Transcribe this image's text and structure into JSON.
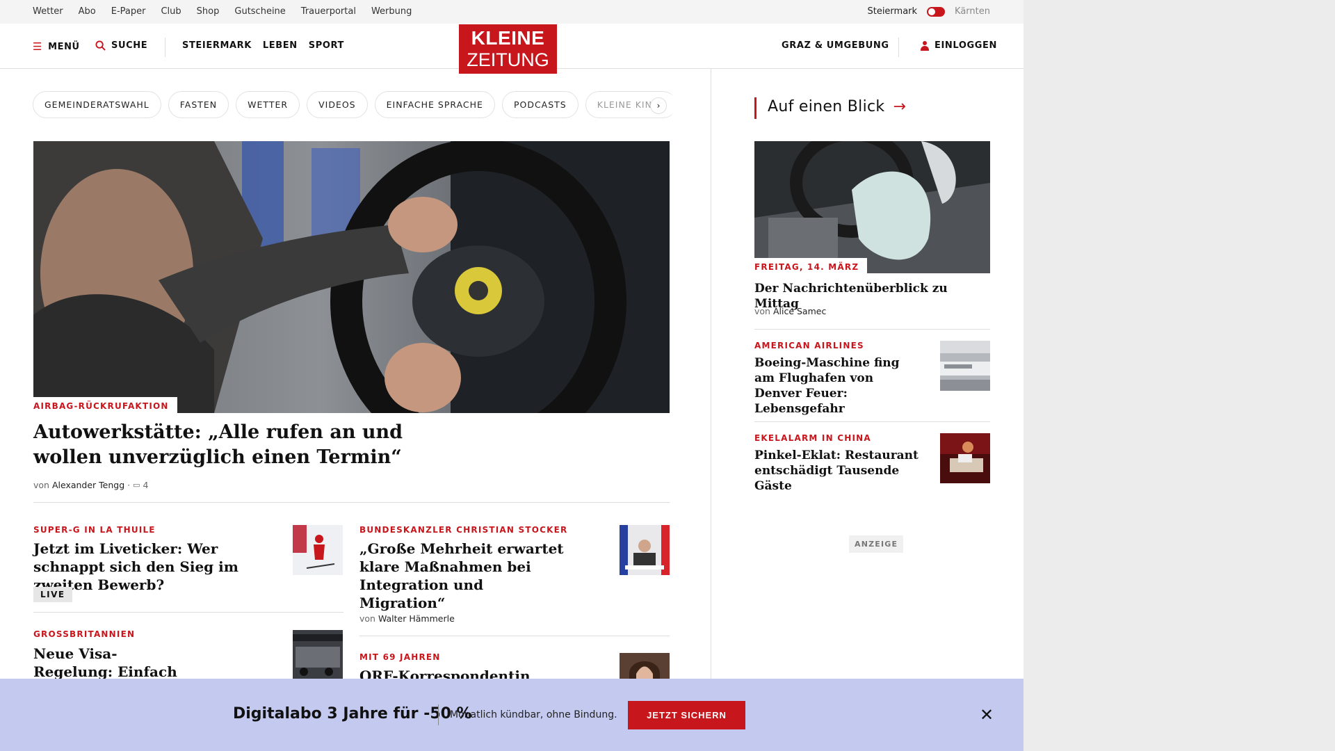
{
  "utility": {
    "links": [
      "Wetter",
      "Abo",
      "E-Paper",
      "Club",
      "Shop",
      "Gutscheine",
      "Trauerportal",
      "Werbung"
    ],
    "region_left": "Steiermark",
    "region_right": "Kärnten"
  },
  "header": {
    "menu": "MENÜ",
    "search": "SUCHE",
    "sections": [
      "STEIERMARK",
      "LEBEN",
      "SPORT"
    ],
    "logo_line1": "KLEINE",
    "logo_line2": "ZEITUNG",
    "graz": "GRAZ & UMGEBUNG",
    "login": "EINLOGGEN"
  },
  "pills": [
    "GEMEINDERATSWAHL",
    "FASTEN",
    "WETTER",
    "VIDEOS",
    "EINFACHE SPRACHE",
    "PODCASTS",
    "KLEINE KINDE"
  ],
  "hero": {
    "kicker": "AIRBAG-RÜCKRUFAKTION",
    "title": "Autowerkstätte: „Alle rufen an und wollen unverzüglich einen Termin“",
    "by_prefix": "von",
    "author": "Alexander Tengg",
    "comments": "4"
  },
  "articles": {
    "a1": {
      "kicker": "SUPER-G IN LA THUILE",
      "title": "Jetzt im Liveticker: Wer schnappt sich den Sieg im zweiten Bewerb?",
      "badge": "LIVE"
    },
    "a2": {
      "kicker": "BUNDESKANZLER CHRISTIAN STOCKER",
      "title": "„Große Mehrheit erwartet klare Maßnahmen bei Integration und Migration“",
      "by_prefix": "von",
      "author": "Walter Hämmerle"
    },
    "a3": {
      "kicker": "GROSSBRITANNIEN",
      "title": "Neue Visa-Regelung: Einfach Einreisen ist"
    },
    "a4": {
      "kicker": "MIT 69 JAHREN",
      "title": "ORF-Korrespondentin"
    }
  },
  "sidebar": {
    "heading": "Auf einen Blick",
    "item1": {
      "kicker": "FREITAG, 14. MÄRZ",
      "title": "Der Nachrichtenüberblick zu Mittag",
      "by_prefix": "von",
      "author": "Alice Samec"
    },
    "item2": {
      "kicker": "AMERICAN AIRLINES",
      "title": "Boeing-Maschine fing am Flughafen von Denver Feuer: Lebensgefahr"
    },
    "item3": {
      "kicker": "EKELALARM IN CHINA",
      "title": "Pinkel-Eklat: Restaurant entschädigt Tausende Gäste"
    },
    "ad_label": "ANZEIGE"
  },
  "promo": {
    "title": "Digitalabo 3 Jahre für -50 %",
    "subtitle": "Monatlich kündbar, ohne Bindung.",
    "button": "JETZT SICHERN"
  },
  "colors": {
    "brand_red": "#c8161d",
    "promo_bg": "#c4c9f0"
  }
}
